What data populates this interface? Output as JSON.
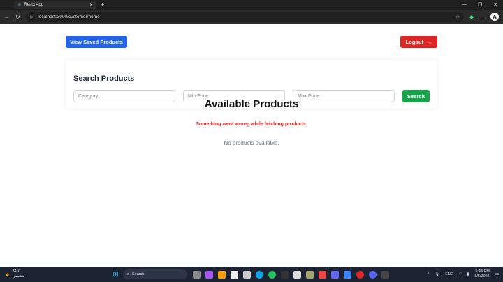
{
  "browser": {
    "tab_title": "React App",
    "url": "localhost:3000/customer/home"
  },
  "header": {
    "saved_label": "View Saved Products",
    "logout_label": "Logout",
    "logout_arrow": "→"
  },
  "search": {
    "title": "Search Products",
    "category_placeholder": "Category",
    "min_placeholder": "Min Price",
    "max_placeholder": "Max Price",
    "button": "Search"
  },
  "products": {
    "title": "Available Products",
    "error": "Something went wrong while fetching products.",
    "empty": "No products available."
  },
  "taskbar": {
    "temp": "34°C",
    "weather": "مشمس",
    "search": "Search",
    "lang": "ENG",
    "time": "5:44 PM",
    "date": "8/5/2025"
  },
  "colors": {
    "blue": "#2563eb",
    "red": "#dc2626",
    "green": "#16a34a"
  }
}
